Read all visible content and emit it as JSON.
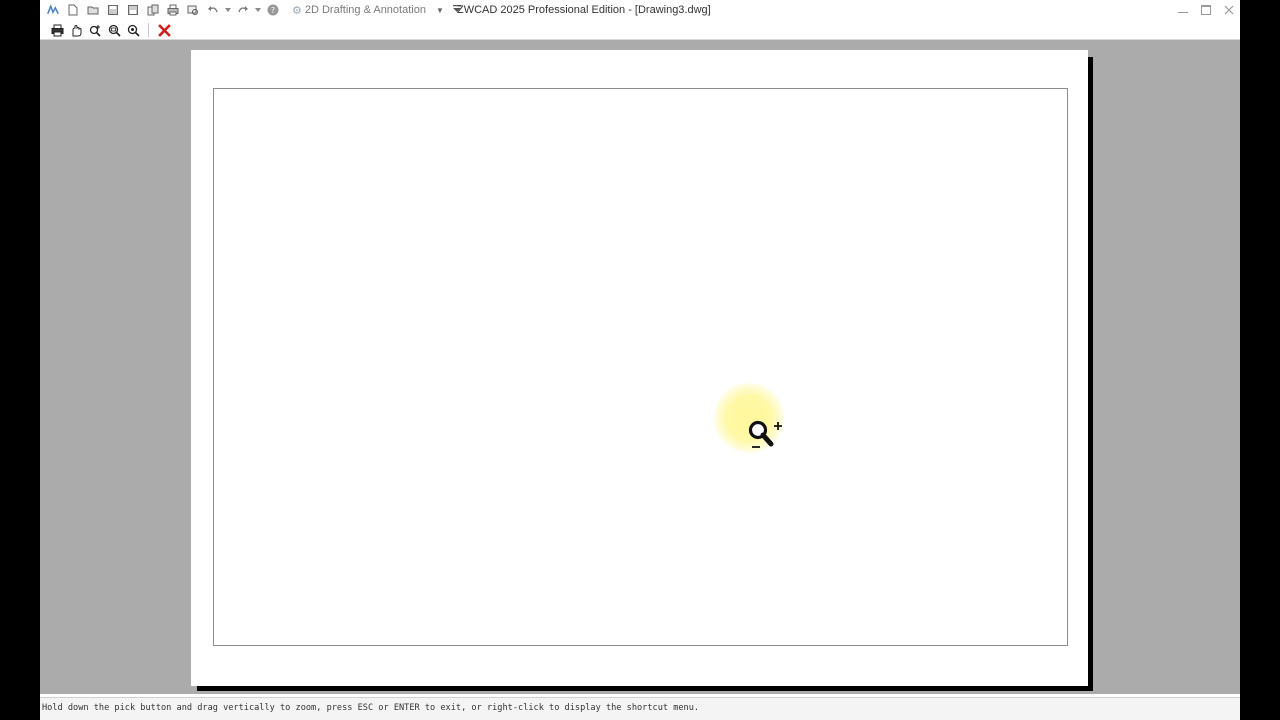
{
  "window": {
    "title": "ZWCAD 2025 Professional Edition - [Drawing3.dwg]",
    "workspace": "2D Drafting & Annotation"
  },
  "quick_access": [
    {
      "name": "new-file-icon"
    },
    {
      "name": "open-folder-icon"
    },
    {
      "name": "save-icon"
    },
    {
      "name": "save-as-icon"
    },
    {
      "name": "publish-icon"
    },
    {
      "name": "print-icon"
    },
    {
      "name": "print-preview-icon"
    },
    {
      "name": "undo-icon"
    },
    {
      "name": "redo-icon"
    },
    {
      "name": "help-icon"
    }
  ],
  "preview_toolbar": [
    {
      "name": "print-icon"
    },
    {
      "name": "pan-icon"
    },
    {
      "name": "zoom-realtime-icon"
    },
    {
      "name": "zoom-window-icon"
    },
    {
      "name": "zoom-original-icon"
    },
    {
      "name": "close-preview-icon"
    }
  ],
  "status": {
    "prompt": "Hold down the pick button and drag vertically to zoom, press ESC or ENTER to exit, or right-click to display the shortcut menu."
  },
  "colors": {
    "canvas_background": "#ababab",
    "paper": "#ffffff",
    "close_preview": "#cc1f1f",
    "cursor_highlight": "#fff796"
  }
}
